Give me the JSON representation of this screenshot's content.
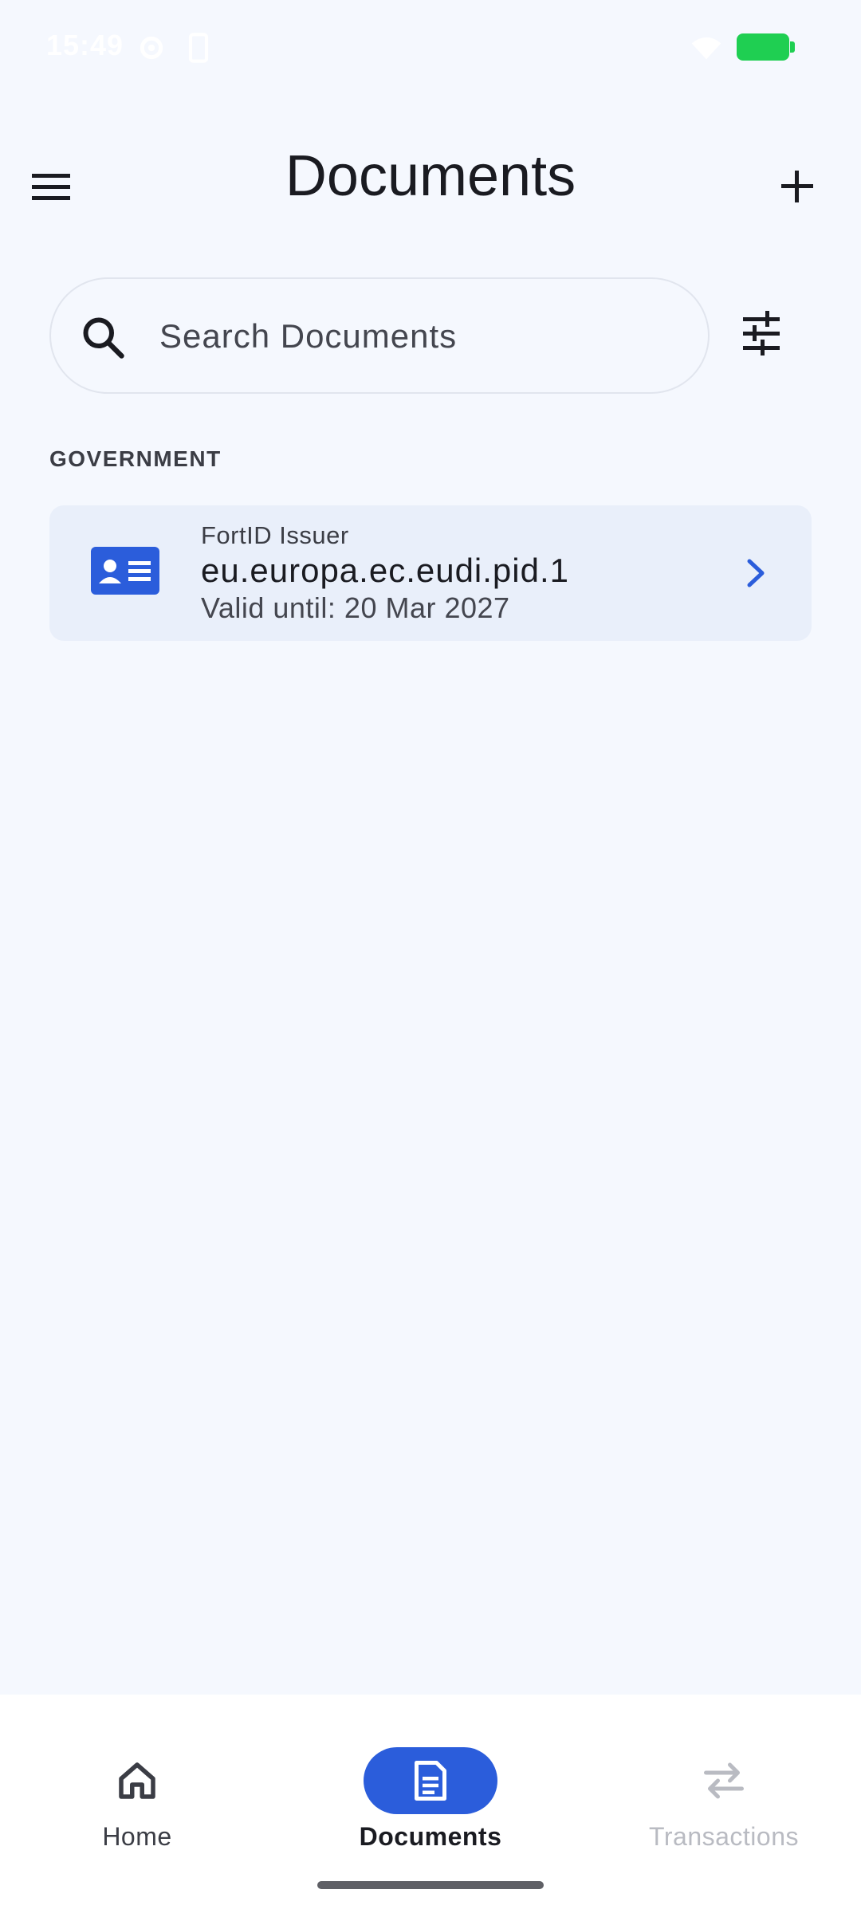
{
  "status_bar": {
    "time": "15:49",
    "icons": [
      "settings-gear-icon",
      "phone-outline-icon",
      "wifi-icon",
      "battery-icon"
    ],
    "battery_color": "#1fcf52"
  },
  "header": {
    "title": "Documents",
    "menu_icon": "hamburger-menu-icon",
    "add_icon": "plus-icon"
  },
  "search": {
    "placeholder": "Search Documents",
    "value": "",
    "filter_icon": "tune-sliders-icon"
  },
  "sections": [
    {
      "title": "GOVERNMENT",
      "documents": [
        {
          "issuer": "FortID Issuer",
          "name": "eu.europa.ec.eudi.pid.1",
          "validity": "Valid until: 20 Mar 2027",
          "icon": "id-card-icon"
        }
      ]
    }
  ],
  "bottom_nav": {
    "items": [
      {
        "label": "Home",
        "icon": "home-icon",
        "state": "normal"
      },
      {
        "label": "Documents",
        "icon": "document-icon",
        "state": "selected"
      },
      {
        "label": "Transactions",
        "icon": "swap-arrows-icon",
        "state": "disabled"
      }
    ]
  },
  "colors": {
    "accent": "#2b5ddb",
    "background": "#f5f8fe",
    "card": "#e9effa"
  }
}
